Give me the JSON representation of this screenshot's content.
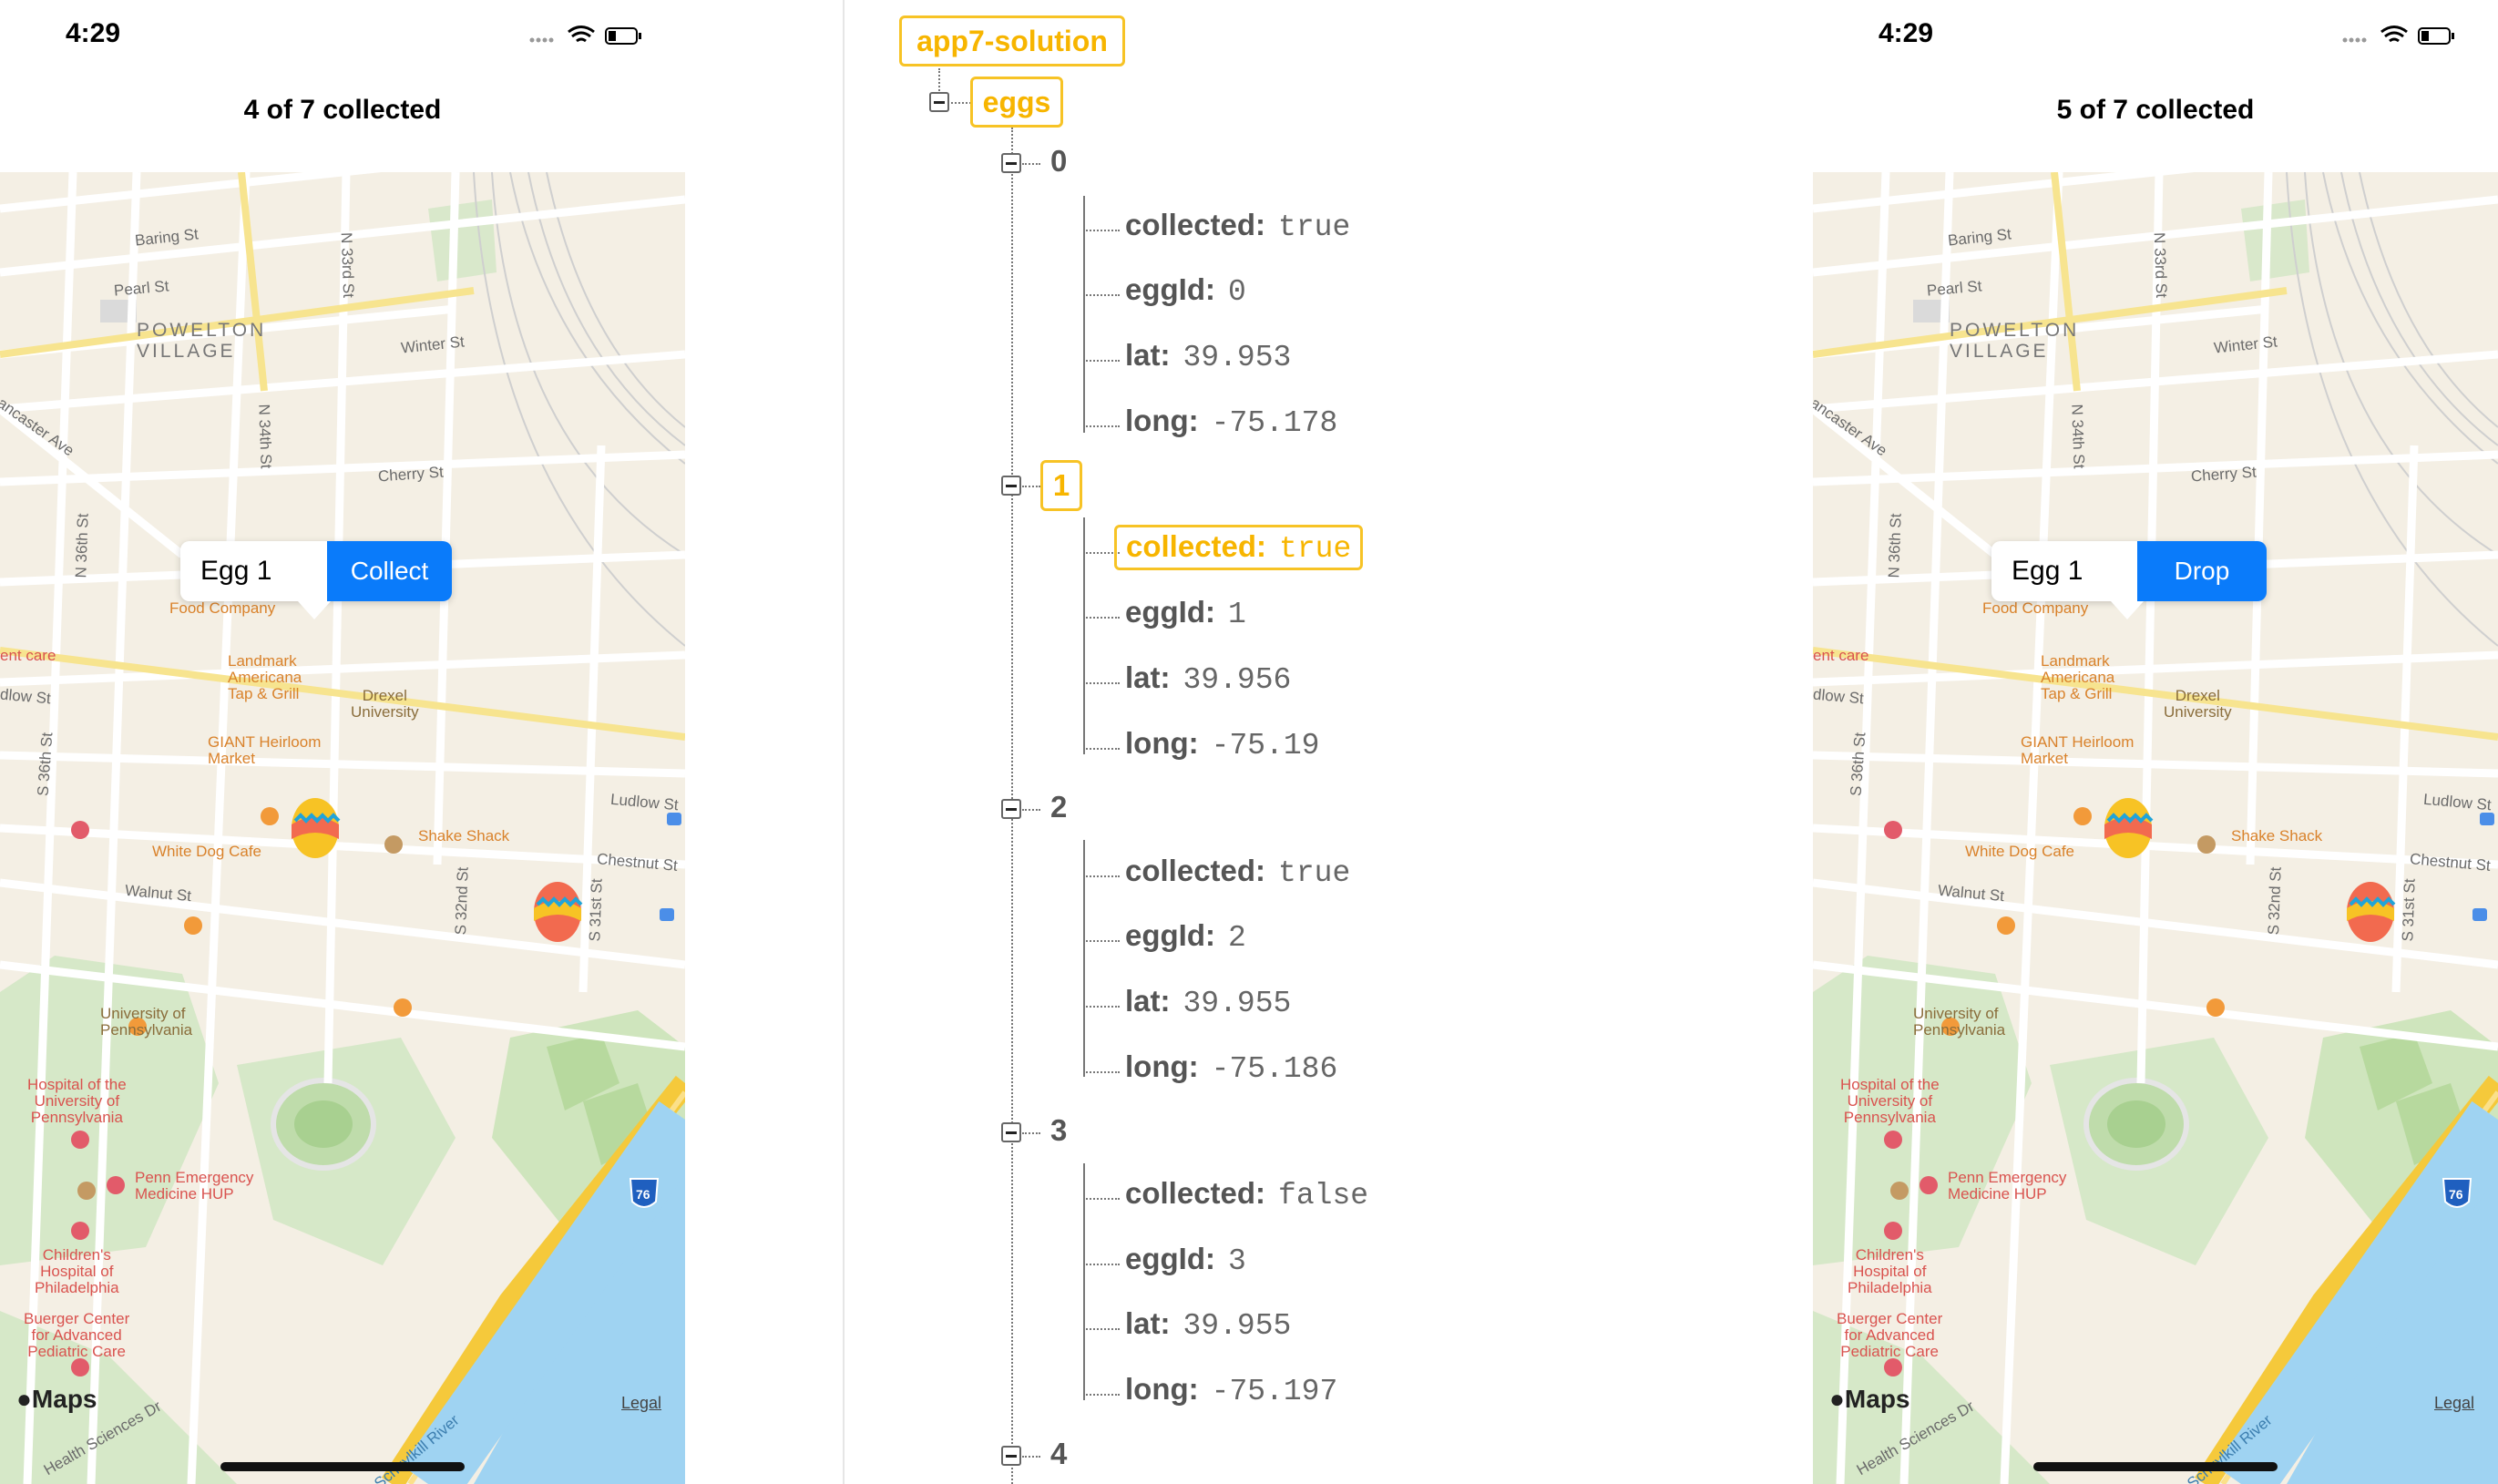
{
  "left_phone": {
    "time": "4:29",
    "nav_title": "4 of 7 collected",
    "callout_title": "Egg 1",
    "callout_button": "Collect"
  },
  "right_phone": {
    "time": "4:29",
    "nav_title": "5 of 7 collected",
    "callout_title": "Egg 1",
    "callout_button": "Drop"
  },
  "map_labels": {
    "baring": "Baring St",
    "pearl": "Pearl St",
    "district": "POWELTON\nVILLAGE",
    "winter": "Winter St",
    "n33": "N 33rd St",
    "n34": "N 34th St",
    "lancaster": "ancaster Ave",
    "cherry": "Cherry St",
    "n36": "N 36th St",
    "food_company": "Food Company",
    "urgent": "ent care",
    "ludlow_w": "dlow St",
    "landmark": "Landmark\nAmericana\nTap & Grill",
    "drexel": "Drexel\nUniversity",
    "giant": "GIANT Heirloom\nMarket",
    "s36": "S 36th St",
    "ludlow": "Ludlow St",
    "white_dog": "White Dog Cafe",
    "shake_shack": "Shake Shack",
    "chestnut": "Chestnut St",
    "walnut": "Walnut St",
    "s32": "S 32nd St",
    "s31": "S 31st St",
    "upenn": "University of\nPennsylvania",
    "hup": "Hospital of the\nUniversity of\nPennsylvania",
    "penn_emergency": "Penn Emergency\nMedicine HUP",
    "chop": "Children's\nHospital of\nPhiladelphia",
    "buerger": "Buerger Center\nfor Advanced\nPediatric Care",
    "health_sciences": "Health Sciences Dr",
    "schuylkill": "Schuylkill River",
    "i76": "76",
    "maps": "Maps",
    "legal": "Legal"
  },
  "tree": {
    "root": "app7-solution",
    "child": "eggs",
    "items": [
      {
        "index": "0",
        "collected": "true",
        "eggId": "0",
        "lat": "39.953",
        "long": "-75.178"
      },
      {
        "index": "1",
        "collected": "true",
        "eggId": "1",
        "lat": "39.956",
        "long": "-75.19"
      },
      {
        "index": "2",
        "collected": "true",
        "eggId": "2",
        "lat": "39.955",
        "long": "-75.186"
      },
      {
        "index": "3",
        "collected": "false",
        "eggId": "3",
        "lat": "39.955",
        "long": "-75.197"
      },
      {
        "index": "4"
      }
    ],
    "keys": {
      "collected": "collected:",
      "eggId": "eggId:",
      "lat": "lat:",
      "long": "long:"
    }
  },
  "colors": {
    "highlight": "#f7c325",
    "callout_button": "#0a7bfa",
    "map_background": "#f4efe4",
    "park": "#d6e8c8",
    "river": "#9fd3f2",
    "highway": "#f5c93b"
  }
}
